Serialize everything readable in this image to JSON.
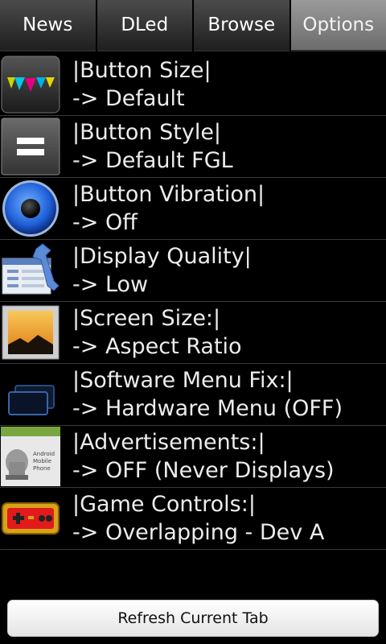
{
  "tabs": [
    {
      "label": "News"
    },
    {
      "label": "DLed"
    },
    {
      "label": "Browse"
    },
    {
      "label": "Options"
    }
  ],
  "active_tab": "Options",
  "options": [
    {
      "title": "|Button Size|",
      "value": "-> Default",
      "icon": "colorful-triangles-icon"
    },
    {
      "title": "|Button Style|",
      "value": "-> Default FGL",
      "icon": "equals-sign-icon"
    },
    {
      "title": "|Button Vibration|",
      "value": "-> Off",
      "icon": "speaker-icon"
    },
    {
      "title": "|Display Quality|",
      "value": "-> Low",
      "icon": "settings-wrench-icon"
    },
    {
      "title": "|Screen Size:|",
      "value": "-> Aspect Ratio",
      "icon": "picture-frame-icon"
    },
    {
      "title": "|Software Menu Fix:|",
      "value": "-> Hardware Menu (OFF)",
      "icon": "overlapping-windows-icon"
    },
    {
      "title": "|Advertisements:|",
      "value": "-> OFF (Never Displays)",
      "icon": "android-phone-icon",
      "icon_text": "Android Mobile Phone"
    },
    {
      "title": "|Game Controls:|",
      "value": "-> Overlapping - Dev A",
      "icon": "game-controller-icon"
    }
  ],
  "footer": {
    "refresh_label": "Refresh Current Tab"
  }
}
